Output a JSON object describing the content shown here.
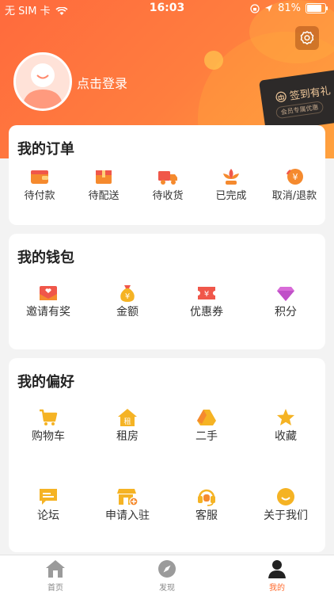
{
  "status_bar": {
    "carrier": "无 SIM 卡",
    "time": "16:03",
    "battery": "81%",
    "battery_level": 0.81
  },
  "profile": {
    "login_label": "点击登录"
  },
  "signin_card": {
    "title": "签到有礼",
    "subtitle": "会员专属优惠"
  },
  "orders": {
    "title": "我的订单",
    "items": [
      {
        "label": "待付款",
        "icon": "wallet-icon"
      },
      {
        "label": "待配送",
        "icon": "package-icon"
      },
      {
        "label": "待收货",
        "icon": "truck-icon"
      },
      {
        "label": "已完成",
        "icon": "lotus-icon"
      },
      {
        "label": "取消/退款",
        "icon": "refund-icon"
      }
    ]
  },
  "wallet": {
    "title": "我的钱包",
    "items": [
      {
        "label": "邀请有奖",
        "icon": "invite-envelope-icon"
      },
      {
        "label": "金额",
        "icon": "money-bag-icon"
      },
      {
        "label": "优惠券",
        "icon": "coupon-icon"
      },
      {
        "label": "积分",
        "icon": "diamond-icon"
      }
    ]
  },
  "preferences": {
    "title": "我的偏好",
    "items": [
      {
        "label": "购物车",
        "icon": "cart-icon"
      },
      {
        "label": "租房",
        "icon": "rent-house-icon"
      },
      {
        "label": "二手",
        "icon": "second-hand-icon"
      },
      {
        "label": "收藏",
        "icon": "star-icon"
      },
      {
        "label": "论坛",
        "icon": "forum-icon"
      },
      {
        "label": "申请入驻",
        "icon": "store-apply-icon"
      },
      {
        "label": "客服",
        "icon": "headset-icon"
      },
      {
        "label": "关于我们",
        "icon": "smile-icon"
      }
    ]
  },
  "tabbar": {
    "items": [
      {
        "label": "首页",
        "icon": "home-icon"
      },
      {
        "label": "发现",
        "icon": "compass-icon"
      },
      {
        "label": "我的",
        "icon": "user-icon"
      }
    ],
    "active": "我的"
  },
  "colors": {
    "accent": "#ff6a2d",
    "header_start": "#ff6a3d",
    "header_end": "#ff9d3f",
    "icon_yellow": "#f5b324",
    "icon_orange": "#f58a2e",
    "icon_red": "#f0574a"
  }
}
